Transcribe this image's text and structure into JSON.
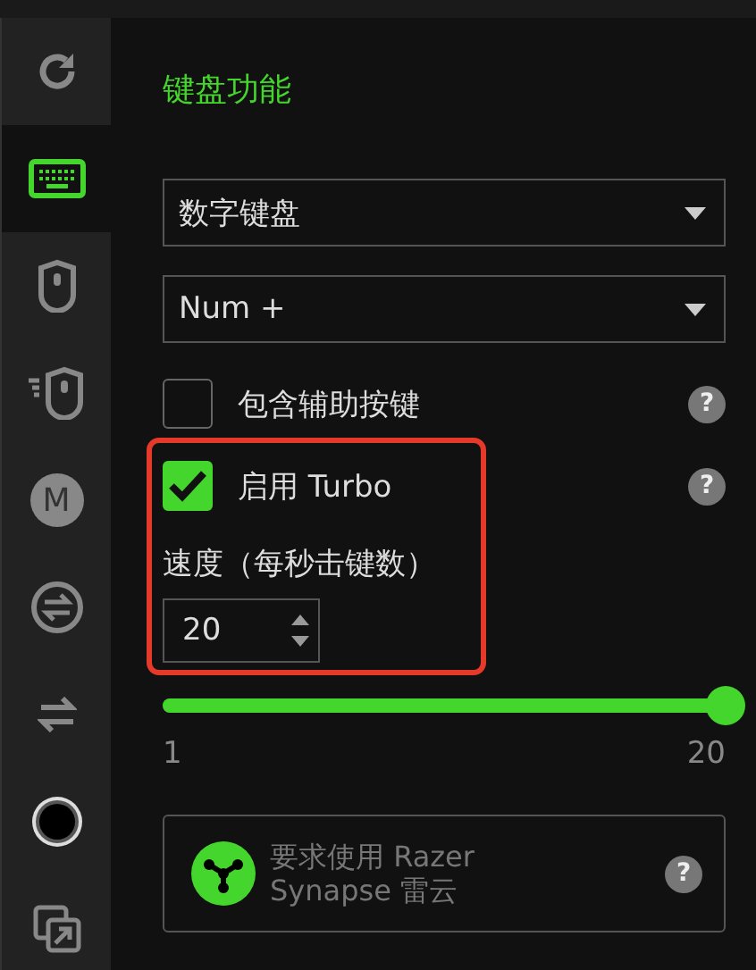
{
  "sidebar": {
    "items": [
      {
        "kind": "refresh",
        "selected": false
      },
      {
        "kind": "keyboard",
        "selected": true
      },
      {
        "kind": "mouse",
        "selected": false
      },
      {
        "kind": "mouse-fast",
        "selected": false
      },
      {
        "kind": "macro",
        "label": "M",
        "selected": false
      },
      {
        "kind": "swap-circle",
        "selected": false
      },
      {
        "kind": "swap",
        "selected": false
      },
      {
        "kind": "audio-jack",
        "selected": false
      },
      {
        "kind": "launch",
        "selected": false
      }
    ]
  },
  "panel": {
    "title": "键盘功能",
    "dropdowns": [
      {
        "value": "数字键盘"
      },
      {
        "value": "Num +"
      }
    ],
    "options": [
      {
        "label": "包含辅助按键",
        "checked": false,
        "help": "?"
      },
      {
        "label": "启用 Turbo",
        "checked": true,
        "help": "?"
      }
    ],
    "speed": {
      "label": "速度（每秒击键数）",
      "value": "20",
      "level": 1,
      "min": "1",
      "max": "20"
    },
    "notice": {
      "text": "要求使用 Razer Synapse 雷云",
      "help": "?"
    }
  }
}
